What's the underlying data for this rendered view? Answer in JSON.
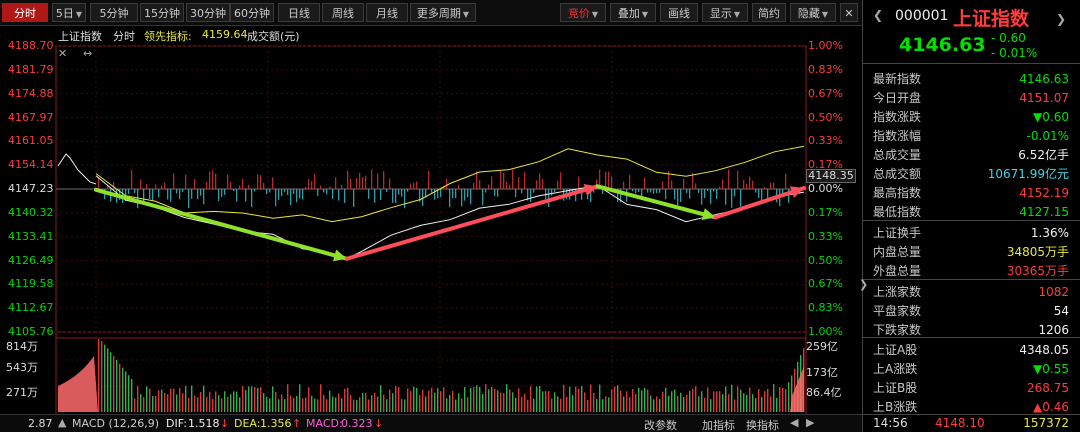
{
  "toolbar": {
    "tabs": [
      "分时",
      "5日",
      "5分钟",
      "15分钟",
      "30分钟",
      "60分钟",
      "日线",
      "周线",
      "月线",
      "更多周期"
    ],
    "right_buttons": [
      "竞价",
      "叠加",
      "画线",
      "显示",
      "简约",
      "隐藏"
    ]
  },
  "chart": {
    "header": {
      "name": "上证指数",
      "mode": "分时",
      "leading_label": "领先指标:",
      "leading_value": "4159.64",
      "volume_label": "成交额(元)"
    },
    "price_ticks": [
      "4188.70",
      "4181.79",
      "4174.88",
      "4167.97",
      "4161.05",
      "4154.14",
      "4147.23",
      "4140.32",
      "4133.41",
      "4126.49",
      "4119.58",
      "4112.67",
      "4105.76"
    ],
    "pct_ticks": [
      "1.00%",
      "0.83%",
      "0.67%",
      "0.50%",
      "0.33%",
      "0.17%",
      "0.00%",
      "0.17%",
      "0.33%",
      "0.50%",
      "0.67%",
      "0.83%",
      "1.00%"
    ],
    "current_price_tag": "4148.35",
    "vol_ticks_left": [
      "814万",
      "543万",
      "271万"
    ],
    "vol_ticks_right": [
      "259亿",
      "173亿",
      "86.4亿"
    ],
    "macd": {
      "label": "MACD (12,26,9)",
      "dif_label": "DIF:",
      "dif_value": "1.518",
      "dea_label": "DEA:",
      "dea_value": "1.356",
      "macd_label": "MACD:",
      "macd_value": "0.323",
      "bottom_left": "2.87",
      "buttons": [
        "改参数",
        "加指标",
        "换指标"
      ]
    }
  },
  "chart_data": {
    "type": "line",
    "title": "上证指数 分时",
    "ylim": [
      4105.76,
      4188.7
    ],
    "base": 4147.23,
    "series": [
      {
        "name": "上证指数",
        "x": [
          0,
          10,
          20,
          30,
          40,
          50,
          60,
          70,
          80,
          85,
          90,
          100,
          110,
          120,
          130,
          140,
          150,
          160,
          170,
          180,
          190,
          200,
          210,
          220,
          230,
          240
        ],
        "values": [
          4151.07,
          4144.0,
          4142.0,
          4139.0,
          4137.0,
          4135.0,
          4134.0,
          4130.0,
          4128.5,
          4127.15,
          4129.0,
          4134.0,
          4136.5,
          4138.5,
          4141.5,
          4143.0,
          4145.0,
          4147.0,
          4148.0,
          4143.0,
          4141.0,
          4138.0,
          4139.5,
          4142.0,
          4144.5,
          4146.63
        ]
      },
      {
        "name": "领先指标",
        "x": [
          0,
          10,
          20,
          30,
          40,
          50,
          60,
          70,
          80,
          90,
          100,
          110,
          120,
          130,
          140,
          150,
          160,
          170,
          180,
          190,
          200,
          210,
          220,
          230,
          240
        ],
        "values": [
          4152.0,
          4145.0,
          4144.0,
          4140.0,
          4141.0,
          4140.0,
          4139.0,
          4139.5,
          4138.0,
          4139.0,
          4142.0,
          4144.0,
          4149.0,
          4152.0,
          4153.0,
          4155.0,
          4159.0,
          4157.0,
          4156.0,
          4152.0,
          4151.0,
          4152.5,
          4155.0,
          4158.0,
          4159.64
        ]
      }
    ],
    "annotations": [
      {
        "type": "arrow",
        "color": "green",
        "from": [
          0,
          4147.0
        ],
        "to": [
          85,
          4127.0
        ]
      },
      {
        "type": "arrow",
        "color": "red",
        "from": [
          85,
          4127.0
        ],
        "to": [
          170,
          4148.0
        ]
      },
      {
        "type": "arrow",
        "color": "green",
        "from": [
          170,
          4148.0
        ],
        "to": [
          210,
          4139.0
        ]
      },
      {
        "type": "arrow",
        "color": "red",
        "from": [
          210,
          4139.0
        ],
        "to": [
          240,
          4147.5
        ]
      }
    ]
  },
  "panel": {
    "code": "000001",
    "name": "上证指数",
    "price": "4146.63",
    "change": "- 0.60",
    "change_pct": "- 0.01%",
    "rows": [
      {
        "k": "最新指数",
        "v": "4146.63",
        "c": "green"
      },
      {
        "k": "今日开盘",
        "v": "4151.07",
        "c": "red"
      },
      {
        "k": "指数涨跌",
        "v": "▼0.60",
        "c": "green"
      },
      {
        "k": "指数涨幅",
        "v": "-0.01%",
        "c": "green"
      },
      {
        "k": "总成交量",
        "v": "6.52亿手",
        "c": "white"
      },
      {
        "k": "总成交额",
        "v": "10671.99亿元",
        "c": "cyan"
      },
      {
        "k": "最高指数",
        "v": "4152.19",
        "c": "red"
      },
      {
        "k": "最低指数",
        "v": "4127.15",
        "c": "green"
      },
      {
        "k": "上证换手",
        "v": "1.36%",
        "c": "white"
      },
      {
        "k": "内盘总量",
        "v": "34805万手",
        "c": "yellow"
      },
      {
        "k": "外盘总量",
        "v": "30365万手",
        "c": "red"
      },
      {
        "k": "上涨家数",
        "v": "1082",
        "c": "red"
      },
      {
        "k": "平盘家数",
        "v": "54",
        "c": "white"
      },
      {
        "k": "下跌家数",
        "v": "1206",
        "c": "white"
      },
      {
        "k": "上证A股",
        "v": "4348.05",
        "c": "white"
      },
      {
        "k": "上A涨跌",
        "v": "▼0.55",
        "c": "green"
      },
      {
        "k": "上证B股",
        "v": "268.75",
        "c": "red"
      },
      {
        "k": "上B涨跌",
        "v": "▲0.46",
        "c": "red"
      }
    ],
    "tick": {
      "time": "14:56",
      "price": "4148.10",
      "vol": "157372"
    }
  },
  "colors": {
    "up": "#ff3b3b",
    "down": "#00e000",
    "price_line": "#f0f0f0",
    "leading_line": "#e9e93a",
    "arrow_green": "#8fe22a",
    "arrow_red": "#ff4d5a"
  }
}
